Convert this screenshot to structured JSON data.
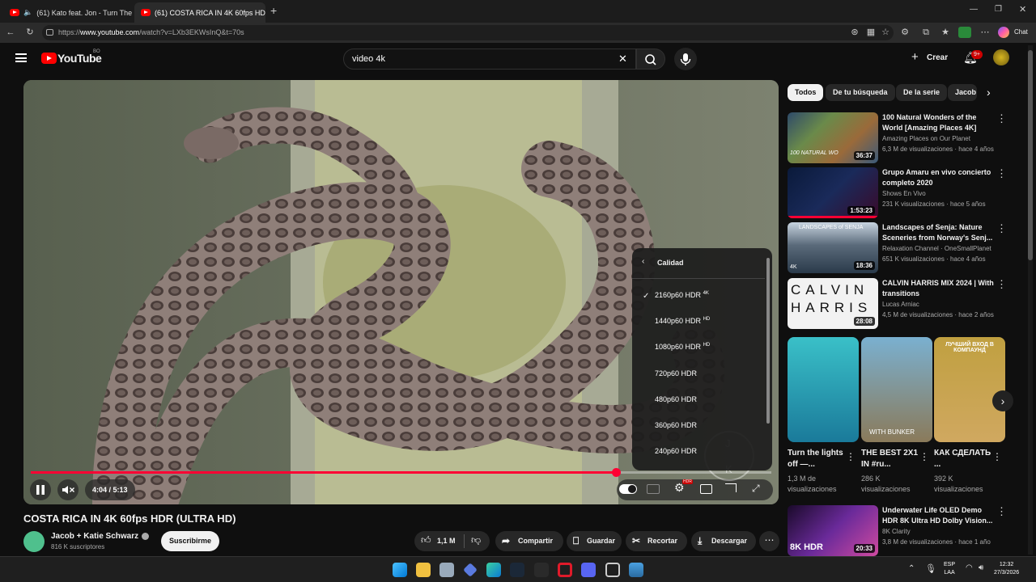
{
  "browser": {
    "tabs": [
      {
        "label": "(61) Kato feat. Jon - Turn The",
        "active": false
      },
      {
        "label": "(61) COSTA RICA IN 4K 60fps HDR",
        "active": true
      }
    ],
    "url_prefix": "https://",
    "url_host": "www.youtube.com",
    "url_path": "/watch?v=LXb3EKWsInQ&t=70s",
    "chat_label": "Chat"
  },
  "youtube": {
    "logo_text": "YouTube",
    "region": "BO",
    "search_value": "video 4k",
    "create_label": "Crear",
    "notif_count": "9+"
  },
  "player": {
    "time": "4:04 / 5:13",
    "progress": 0.79,
    "quality_menu": {
      "title": "Calidad",
      "options": [
        {
          "label": "2160p60 HDR",
          "badge": "4K",
          "selected": true
        },
        {
          "label": "1440p60 HDR",
          "badge": "HD",
          "selected": false
        },
        {
          "label": "1080p60 HDR",
          "badge": "HD",
          "selected": false
        },
        {
          "label": "720p60 HDR",
          "badge": "",
          "selected": false
        },
        {
          "label": "480p60 HDR",
          "badge": "",
          "selected": false
        },
        {
          "label": "360p60 HDR",
          "badge": "",
          "selected": false
        },
        {
          "label": "240p60 HDR",
          "badge": "",
          "selected": false
        }
      ]
    },
    "settings_badge": "HDR",
    "watermark_letters": [
      "J",
      "K"
    ]
  },
  "video": {
    "title": "COSTA RICA IN 4K 60fps HDR (ULTRA HD)",
    "channel": "Jacob + Katie Schwarz",
    "subscribers": "816 K suscriptores",
    "subscribe_label": "Suscribirme",
    "likes": "1,1 M",
    "share_label": "Compartir",
    "save_label": "Guardar",
    "clip_label": "Recortar",
    "download_label": "Descargar"
  },
  "chips": [
    "Todos",
    "De tu búsqueda",
    "De la serie",
    "Jacob"
  ],
  "recommendations": [
    {
      "title": "100 Natural Wonders of the World  [Amazing Places 4K]",
      "channel": "Amazing Places on Our Planet",
      "meta": "6,3 M de visualizaciones · hace 4 años",
      "duration": "36:37",
      "thumb_text": "100 NATURAL WO"
    },
    {
      "title": "Grupo Amaru en vivo concierto completo 2020",
      "channel": "Shows En Vivo",
      "meta": "231 K visualizaciones · hace 5 años",
      "duration": "1:53:23",
      "thumb_text": ""
    },
    {
      "title": "Landscapes of Senja: Nature Sceneries from Norway's Senj...",
      "channel": "Relaxation Channel · OneSmallPlanet",
      "meta": "651 K visualizaciones · hace 4 años",
      "duration": "18:36",
      "thumb_text": "LANDSCAPES of SENJA",
      "badge": "4K"
    },
    {
      "title": "CALVIN HARRIS MIX 2024 | With transitions",
      "channel": "Lucas Arniac",
      "meta": "4,5 M de visualizaciones · hace 2 años",
      "duration": "28:08",
      "thumb_text": "CALVIN HARRIS"
    },
    {
      "title": "Underwater Life OLED Demo HDR 8K Ultra HD Dolby Vision...",
      "channel": "8K Clarity",
      "meta": "3,8 M de visualizaciones · hace 1 año",
      "duration": "20:33",
      "thumb_text": "8K HDR"
    }
  ],
  "shorts": [
    {
      "title": "Turn the lights off —...",
      "views": "1,3 M de visualizaciones",
      "thumb_text": ""
    },
    {
      "title": "THE BEST 2X1 IN #ru...",
      "views": "286 K visualizaciones",
      "thumb_text": "WITH BUNKER"
    },
    {
      "title": "КАК СДЕЛАТЬ ...",
      "views": "392 K visualizaciones",
      "thumb_text": "ЛУЧШИЙ ВХОД В КОМПАУНД"
    }
  ],
  "taskbar": {
    "lang": "ESP",
    "lang_sub": "LAA",
    "time": "12:32",
    "date": "27/3/2026"
  },
  "colors": {
    "accent": "#ff0033",
    "bg": "#0f0f0f"
  }
}
